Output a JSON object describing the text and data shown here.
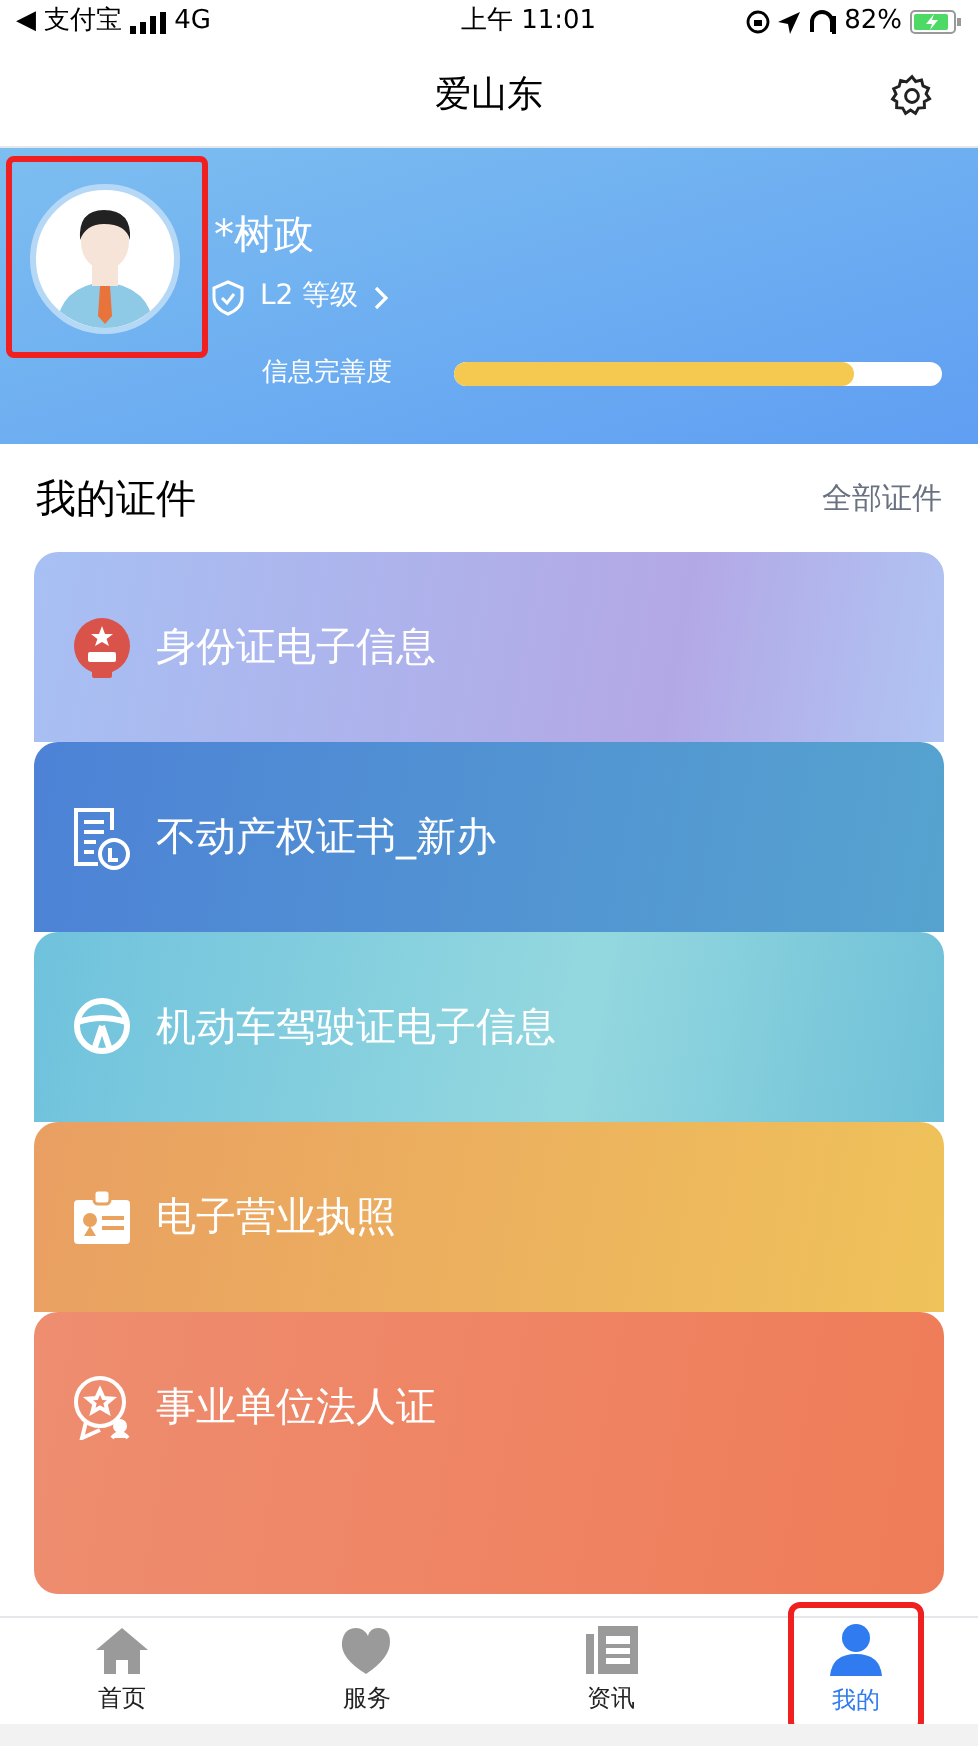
{
  "status_bar": {
    "back_app": "◀ 支付宝",
    "network": "4G",
    "time": "上午 11:01",
    "battery_percent": "82%"
  },
  "nav": {
    "title": "爱山东"
  },
  "profile": {
    "name": "*树政",
    "level": "L2 等级",
    "completeness_label": "信息完善度",
    "completeness": {
      "level": 0.82
    },
    "highlighted": true
  },
  "section": {
    "title": "我的证件",
    "link": "全部证件"
  },
  "cards": [
    {
      "kind": "emblem",
      "label": "身份证电子信息"
    },
    {
      "kind": "property",
      "label": "不动产权证书_新办"
    },
    {
      "kind": "wheel",
      "label": "机动车驾驶证电子信息"
    },
    {
      "kind": "badge",
      "label": "电子营业执照"
    },
    {
      "kind": "award",
      "label": "事业单位法人证"
    }
  ],
  "tabs": [
    {
      "kind": "home",
      "label": "首页",
      "selected": false,
      "highlighted": false
    },
    {
      "kind": "heart",
      "label": "服务",
      "selected": false,
      "highlighted": false
    },
    {
      "kind": "news",
      "label": "资讯",
      "selected": false,
      "highlighted": false
    },
    {
      "kind": "person",
      "label": "我的",
      "selected": true,
      "highlighted": true
    }
  ]
}
